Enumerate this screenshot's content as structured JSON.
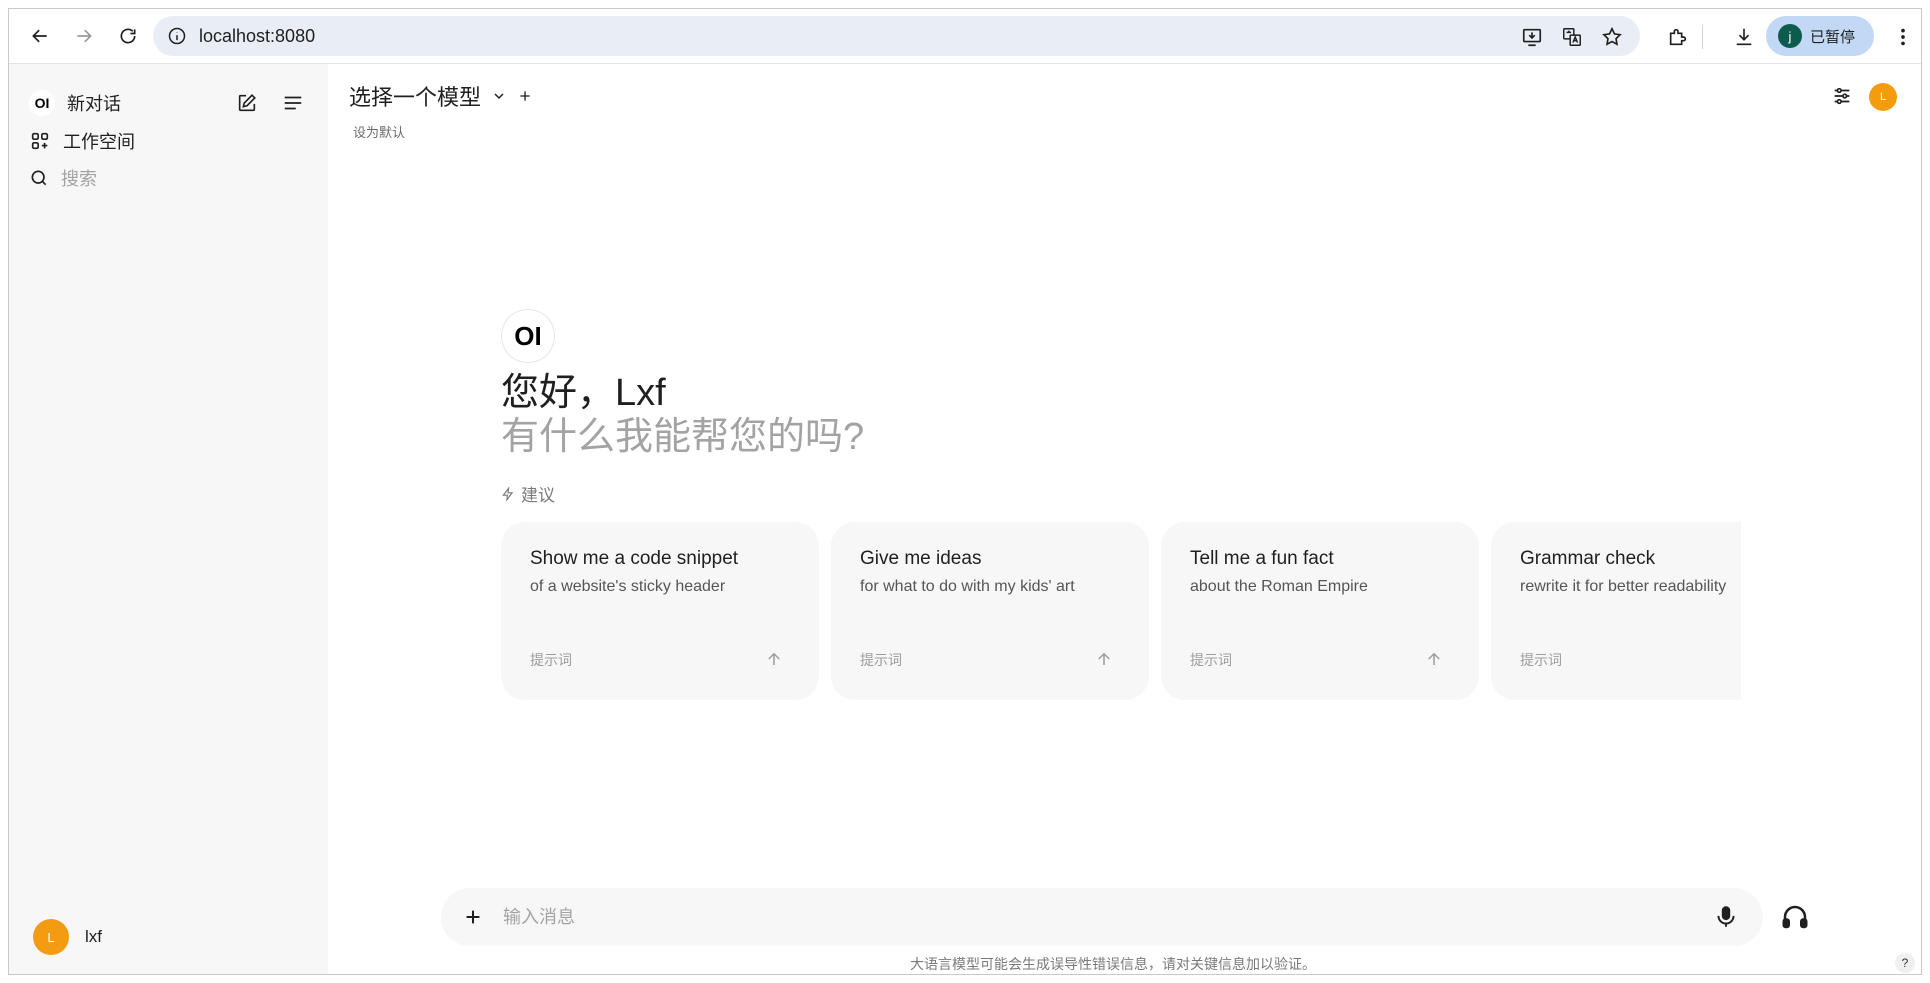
{
  "browser": {
    "url": "localhost:8080",
    "profile_initial": "j",
    "profile_status": "已暂停"
  },
  "sidebar": {
    "new_chat": "新对话",
    "logo_text": "OI",
    "workspace": "工作空间",
    "search_placeholder": "搜索",
    "user_initial": "L",
    "user_name": "lxf"
  },
  "header": {
    "model_select": "选择一个模型",
    "set_default": "设为默认",
    "user_initial": "L"
  },
  "welcome": {
    "logo_text": "OI",
    "greeting": "您好，Lxf",
    "subtitle": "有什么我能帮您的吗?",
    "suggest_label": "建议"
  },
  "suggestions": [
    {
      "title": "Show me a code snippet",
      "subtitle": "of a website's sticky header",
      "tag": "提示词"
    },
    {
      "title": "Give me ideas",
      "subtitle": "for what to do with my kids' art",
      "tag": "提示词"
    },
    {
      "title": "Tell me a fun fact",
      "subtitle": "about the Roman Empire",
      "tag": "提示词"
    },
    {
      "title": "Grammar check",
      "subtitle": "rewrite it for better readability",
      "tag": "提示词"
    }
  ],
  "composer": {
    "placeholder": "输入消息"
  },
  "footer": {
    "disclaimer": "大语言模型可能会生成误导性错误信息，请对关键信息加以验证。",
    "help": "?"
  },
  "colors": {
    "accent_avatar": "#f39c12",
    "sidebar_bg": "#f7f7f7",
    "omnibox_bg": "#e9eef6"
  }
}
